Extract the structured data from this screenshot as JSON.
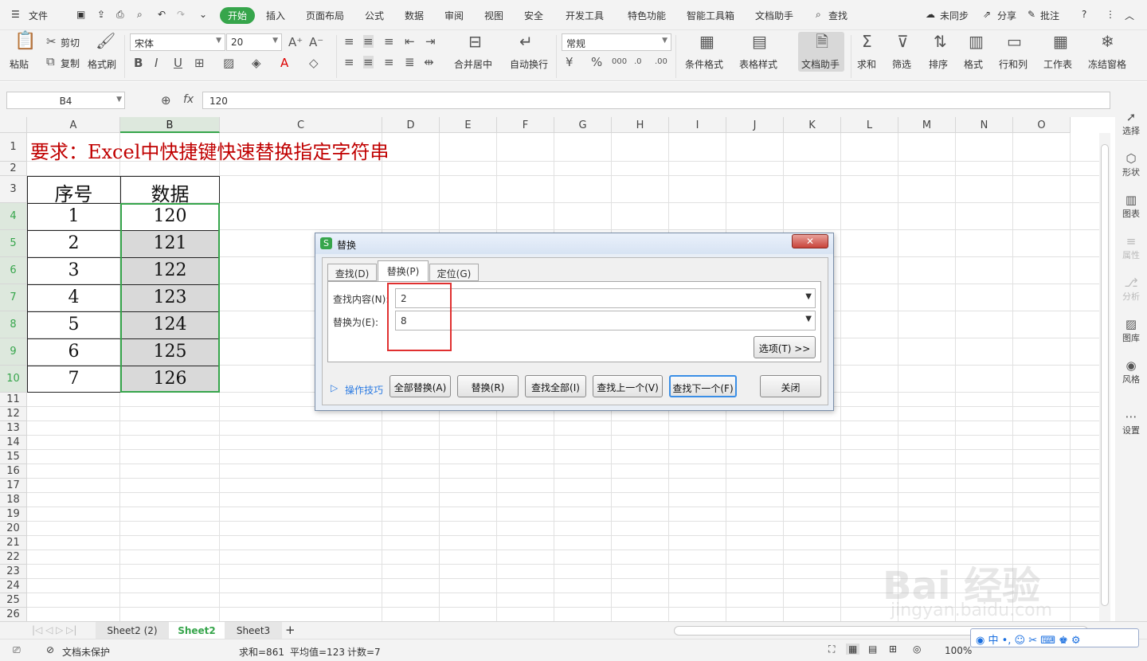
{
  "menubar": {
    "file": "文件",
    "tabs": [
      "开始",
      "插入",
      "页面布局",
      "公式",
      "数据",
      "审阅",
      "视图",
      "安全",
      "开发工具",
      "特色功能",
      "智能工具箱",
      "文档助手"
    ],
    "search": "查找",
    "sync": "未同步",
    "share": "分享",
    "comment": "批注"
  },
  "ribbon": {
    "paste": "粘贴",
    "cut": "剪切",
    "copy": "复制",
    "format_painter": "格式刷",
    "font": "宋体",
    "size": "20",
    "merge": "合并居中",
    "wrap": "自动换行",
    "number_format": "常规",
    "cond_format": "条件格式",
    "table_style": "表格样式",
    "doc_helper": "文档助手",
    "sum": "求和",
    "filter": "筛选",
    "sort": "排序",
    "format": "格式",
    "rowcol": "行和列",
    "worksheet": "工作表",
    "freeze": "冻结窗格"
  },
  "formula": {
    "cell_ref": "B4",
    "fx": "fx",
    "value": "120"
  },
  "grid": {
    "columns": [
      "A",
      "B",
      "C",
      "D",
      "E",
      "F",
      "G",
      "H",
      "I",
      "J",
      "K",
      "L",
      "M",
      "N",
      "O"
    ],
    "rows": [
      "1",
      "2",
      "3",
      "4",
      "5",
      "6",
      "7",
      "8",
      "9",
      "10",
      "11",
      "12",
      "13",
      "14",
      "15",
      "16",
      "17",
      "18",
      "19",
      "20",
      "21",
      "22",
      "23",
      "24",
      "25",
      "26"
    ],
    "title": "要求：Excel中快捷键快速替换指定字符串",
    "headers": [
      "序号",
      "数据"
    ],
    "data": [
      [
        "1",
        "120"
      ],
      [
        "2",
        "121"
      ],
      [
        "3",
        "122"
      ],
      [
        "4",
        "123"
      ],
      [
        "5",
        "124"
      ],
      [
        "6",
        "125"
      ],
      [
        "7",
        "126"
      ]
    ]
  },
  "dialog": {
    "title": "替换",
    "tabs": [
      "查找(D)",
      "替换(P)",
      "定位(G)"
    ],
    "find_label": "查找内容(N):",
    "find_value": "2",
    "replace_label": "替换为(E):",
    "replace_value": "8",
    "options": "选项(T) >>",
    "tips": "操作技巧",
    "buttons": [
      "全部替换(A)",
      "替换(R)",
      "查找全部(I)",
      "查找上一个(V)",
      "查找下一个(F)",
      "关闭"
    ]
  },
  "rpanel": [
    "选择",
    "形状",
    "图表",
    "属性",
    "分析",
    "图库",
    "风格",
    "设置"
  ],
  "sheets": [
    "Sheet2 (2)",
    "Sheet2",
    "Sheet3"
  ],
  "status": {
    "protect": "文档未保护",
    "sum": "求和=861",
    "avg": "平均值=123",
    "count": "计数=7",
    "zoom": "100%"
  },
  "watermark": {
    "brand": "Bai  经验",
    "url": "jingyan.baidu.com"
  },
  "colors": {
    "accent": "#36a54b",
    "title_red": "#c00000",
    "highlight": "#e03030"
  }
}
